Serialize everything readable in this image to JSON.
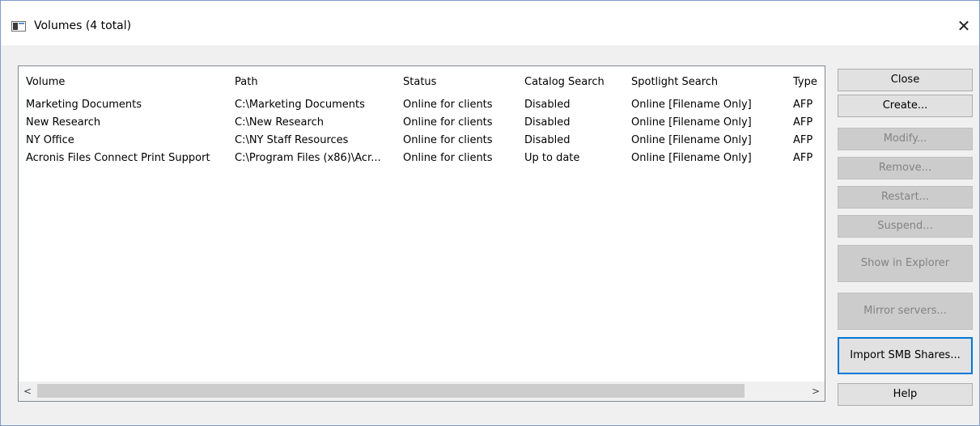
{
  "window": {
    "title": "Volumes (4 total)"
  },
  "list": {
    "columns": [
      "Volume",
      "Path",
      "Status",
      "Catalog Search",
      "Spotlight Search",
      "Type"
    ],
    "rows": [
      [
        "Marketing Documents",
        "C:\\Marketing Documents",
        "Online for clients",
        "Disabled",
        "Online [Filename Only]",
        "AFP"
      ],
      [
        "New Research",
        "C:\\New Research",
        "Online for clients",
        "Disabled",
        "Online [Filename Only]",
        "AFP"
      ],
      [
        "NY Office",
        "C:\\NY Staff Resources",
        "Online for clients",
        "Disabled",
        "Online [Filename Only]",
        "AFP"
      ],
      [
        "Acronis Files Connect Print Support",
        "C:\\Program Files (x86)\\Acr...",
        "Online for clients",
        "Up to date",
        "Online [Filename Only]",
        "AFP"
      ]
    ]
  },
  "buttons": {
    "close": "Close",
    "create": "Create...",
    "modify": "Modify...",
    "remove": "Remove...",
    "restart": "Restart...",
    "suspend": "Suspend...",
    "show_in_explorer": "Show in Explorer",
    "mirror_servers": "Mirror servers...",
    "import_smb": "Import SMB Shares...",
    "help": "Help"
  },
  "scrollbar": {
    "left_arrow": "<",
    "right_arrow": ">"
  },
  "icons": {
    "close_window": "close-icon",
    "app": "window-app-icon"
  }
}
